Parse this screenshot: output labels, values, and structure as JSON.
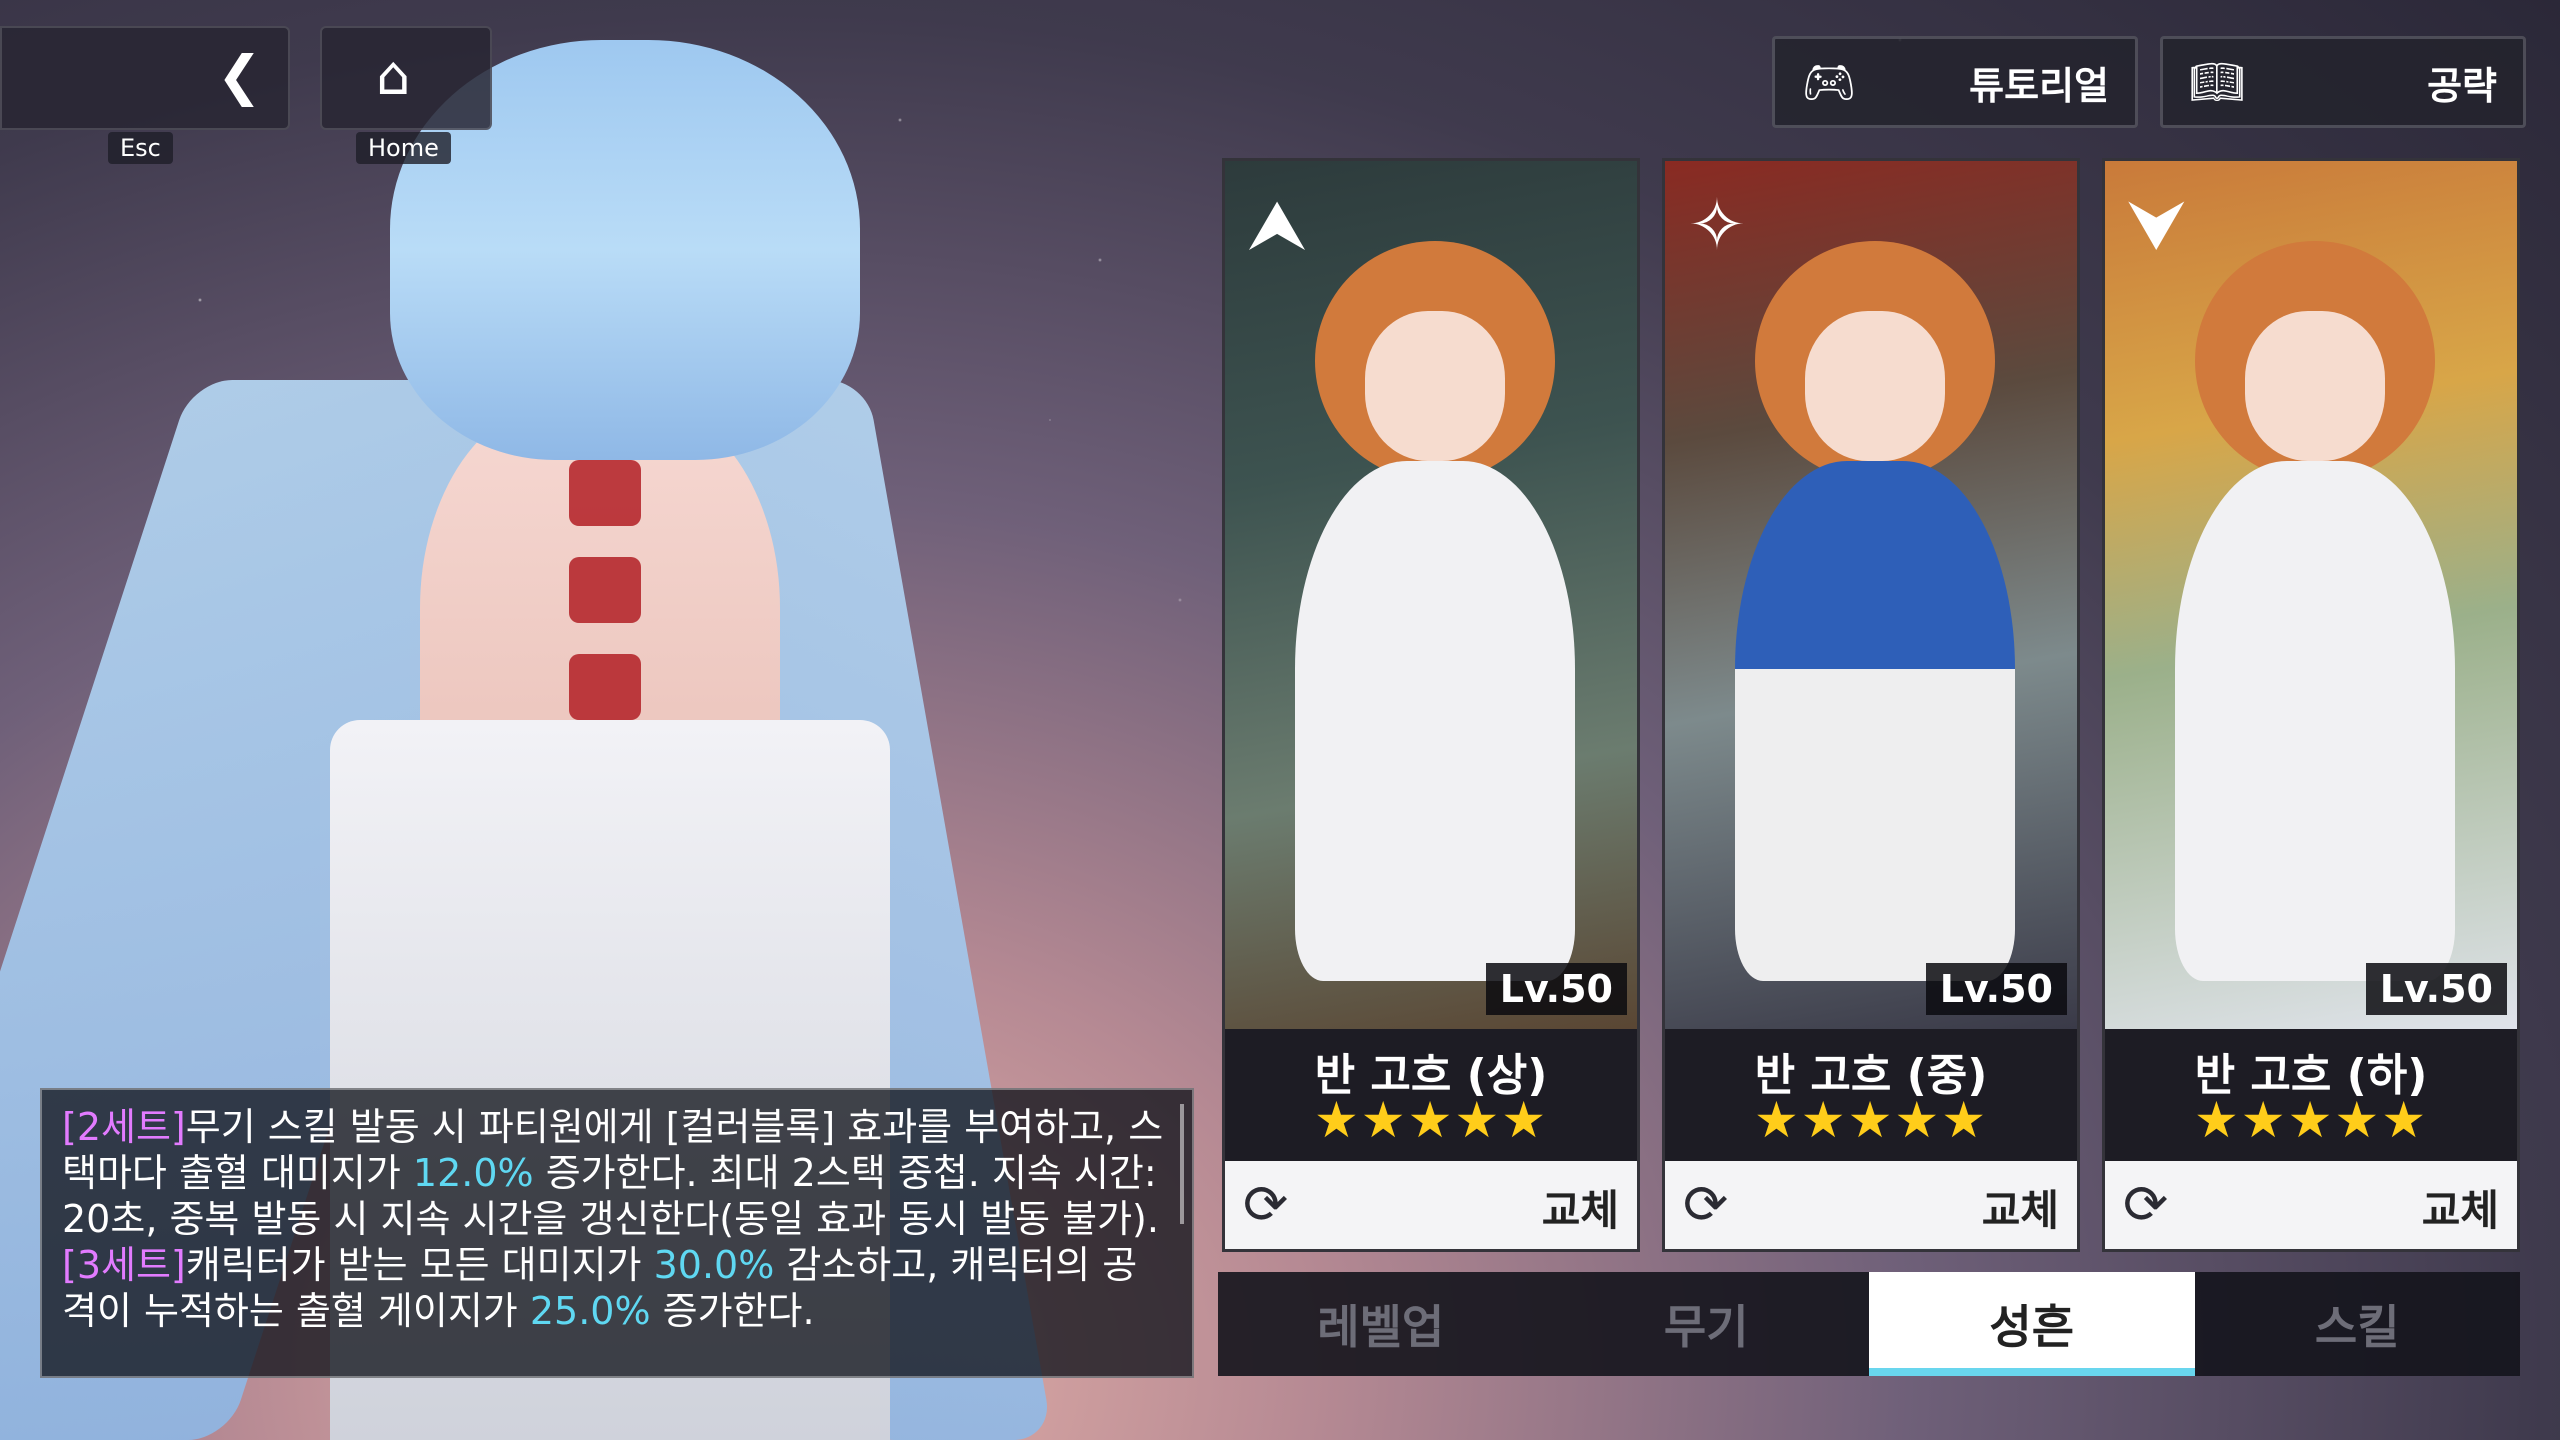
{
  "nav": {
    "back_caption": "Esc",
    "home_caption": "Home"
  },
  "top_buttons": {
    "tutorial_label": "튜토리얼",
    "guide_label": "공략"
  },
  "cards": [
    {
      "name": "반 고흐 (상)",
      "level": "Lv.50",
      "stars": 5,
      "star_text": "★★★★★",
      "swap_label": "교체",
      "emblem": "up-arrow-emblem"
    },
    {
      "name": "반 고흐 (중)",
      "level": "Lv.50",
      "stars": 5,
      "star_text": "★★★★★",
      "swap_label": "교체",
      "emblem": "star-emblem"
    },
    {
      "name": "반 고흐 (하)",
      "level": "Lv.50",
      "stars": 5,
      "star_text": "★★★★★",
      "swap_label": "교체",
      "emblem": "down-arrow-emblem"
    }
  ],
  "tabs": [
    {
      "label": "레벨업",
      "active": false
    },
    {
      "label": "무기",
      "active": false
    },
    {
      "label": "성흔",
      "active": true
    },
    {
      "label": "스킬",
      "active": false
    }
  ],
  "description": {
    "set2_tag": "[2세트]",
    "set2_a": "무기 스킬 발동 시 파티원에게 [컬러블록] 효과를 부여하고, 스택마다 출혈 대미지가 ",
    "set2_num": "12.0%",
    "set2_b": " 증가한다. 최대 2스택 중첩. 지속 시간: 20초, 중복 발동 시 지속 시간을 갱신한다(동일 효과 동시 발동 불가).",
    "set3_tag": "[3세트]",
    "set3_a": "캐릭터가 받는 모든 대미지가 ",
    "set3_num1": "30.0%",
    "set3_b": " 감소하고, 캐릭터의 공격이 누적하는 출혈 게이지가 ",
    "set3_num2": "25.0%",
    "set3_c": " 증가한다."
  },
  "colors": {
    "star": "#ffcd1a",
    "set_tag": "#e27bff",
    "highlight_number": "#5fd8f2",
    "active_tab_underline": "#69d6ee"
  }
}
